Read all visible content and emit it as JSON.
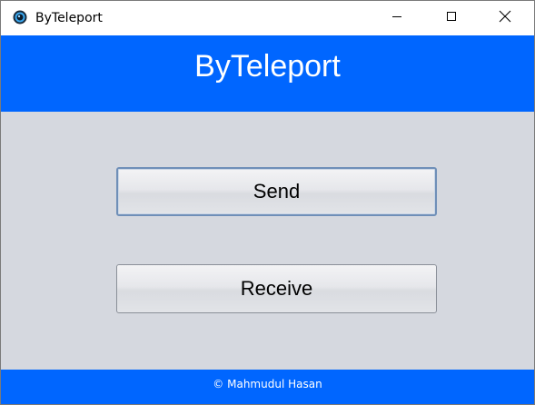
{
  "window": {
    "title": "ByTeleport",
    "icon": "app-logo-icon",
    "controls": {
      "minimize": "minimize-icon",
      "maximize": "maximize-icon",
      "close": "close-icon"
    }
  },
  "header": {
    "title": "ByTeleport",
    "color": "#0066ff"
  },
  "actions": {
    "send_label": "Send",
    "receive_label": "Receive"
  },
  "footer": {
    "text": "© Mahmudul Hasan"
  },
  "colors": {
    "accent": "#0066ff",
    "content_bg": "#d5d8df"
  }
}
